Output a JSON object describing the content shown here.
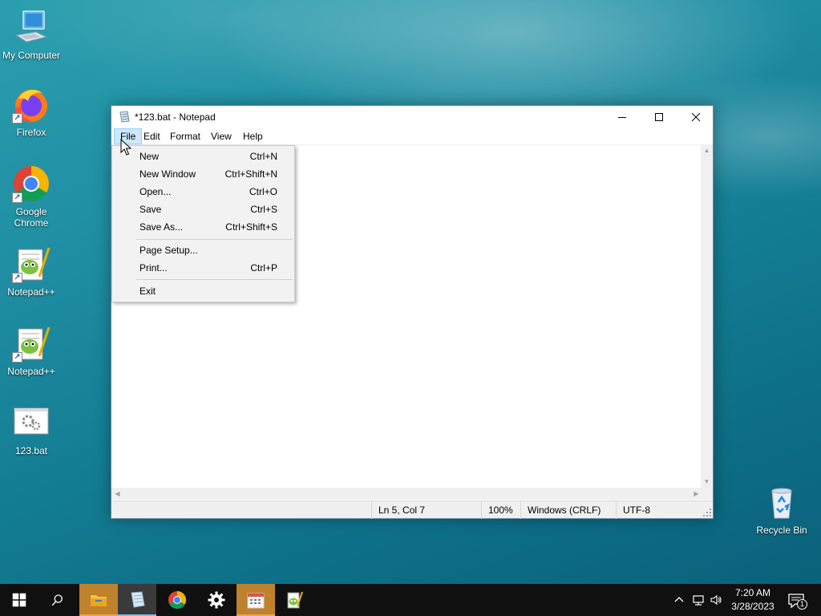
{
  "desktop": {
    "icons": [
      {
        "label": "My Computer",
        "icon": "computer-icon"
      },
      {
        "label": "Firefox",
        "icon": "firefox-icon"
      },
      {
        "label": "Google Chrome",
        "icon": "chrome-icon"
      },
      {
        "label": "Notepad++",
        "icon": "notepadpp-icon"
      },
      {
        "label": "Notepad++",
        "icon": "notepadpp-icon"
      },
      {
        "label": "123.bat",
        "icon": "batch-file-icon"
      },
      {
        "label": "Recycle Bin",
        "icon": "recycle-bin-icon"
      }
    ]
  },
  "window": {
    "title": "*123.bat - Notepad",
    "menu": [
      "File",
      "Edit",
      "Format",
      "View",
      "Help"
    ],
    "status": {
      "position": "Ln 5, Col 7",
      "zoom": "100%",
      "line_ending": "Windows (CRLF)",
      "encoding": "UTF-8"
    }
  },
  "file_menu": {
    "items": [
      {
        "label": "New",
        "shortcut": "Ctrl+N"
      },
      {
        "label": "New Window",
        "shortcut": "Ctrl+Shift+N"
      },
      {
        "label": "Open...",
        "shortcut": "Ctrl+O"
      },
      {
        "label": "Save",
        "shortcut": "Ctrl+S"
      },
      {
        "label": "Save As...",
        "shortcut": "Ctrl+Shift+S"
      },
      {
        "label": "Page Setup...",
        "shortcut": ""
      },
      {
        "label": "Print...",
        "shortcut": "Ctrl+P"
      },
      {
        "label": "Exit",
        "shortcut": ""
      }
    ]
  },
  "taskbar": {
    "time": "7:20 AM",
    "date": "3/28/2023",
    "notification_count": "1"
  },
  "colors": {
    "menu_highlight": "#cce8ff",
    "taskbar": "#101010",
    "running_app": "#c0812d"
  }
}
